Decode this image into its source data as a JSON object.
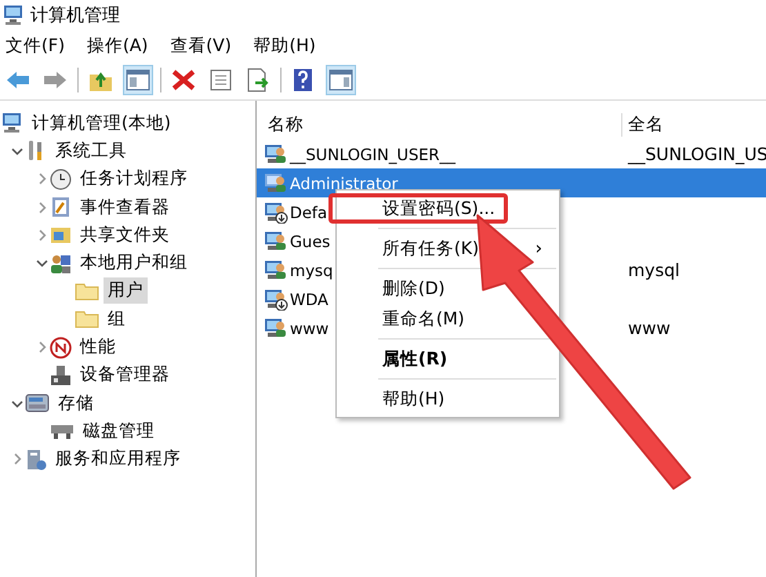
{
  "window": {
    "title": "计算机管理"
  },
  "menu_bar": [
    "文件(F)",
    "操作(A)",
    "查看(V)",
    "帮助(H)"
  ],
  "tree": [
    {
      "label": "计算机管理(本地)",
      "kind": "computer",
      "selected": false,
      "children": [
        {
          "label": "系统工具",
          "kind": "tools",
          "expanded": true,
          "selected": false,
          "children": [
            {
              "label": "任务计划程序",
              "kind": "clock",
              "expanded": false,
              "selected": false
            },
            {
              "label": "事件查看器",
              "kind": "log",
              "expanded": false,
              "selected": false
            },
            {
              "label": "共享文件夹",
              "kind": "share",
              "expanded": false,
              "selected": false
            },
            {
              "label": "本地用户和组",
              "kind": "users",
              "expanded": true,
              "selected": false,
              "children": [
                {
                  "label": "用户",
                  "kind": "folder",
                  "selected": true
                },
                {
                  "label": "组",
                  "kind": "folder",
                  "selected": false
                }
              ]
            },
            {
              "label": "性能",
              "kind": "gauge",
              "expanded": false,
              "selected": false
            },
            {
              "label": "设备管理器",
              "kind": "device",
              "selected": false
            }
          ]
        },
        {
          "label": "存储",
          "kind": "storage",
          "expanded": true,
          "selected": false,
          "children": [
            {
              "label": "磁盘管理",
              "kind": "disk",
              "selected": false
            }
          ]
        },
        {
          "label": "服务和应用程序",
          "kind": "services",
          "expanded": false,
          "selected": false
        }
      ]
    }
  ],
  "list": {
    "columns": [
      "名称",
      "全名"
    ],
    "rows": [
      {
        "name": "__SUNLOGIN_USER__",
        "full_name": "__SUNLOGIN_US",
        "selected": false,
        "disabled": false
      },
      {
        "name": "Administrator",
        "full_name": "",
        "selected": true,
        "disabled": false
      },
      {
        "name": "Defa",
        "full_name": "",
        "selected": false,
        "disabled": true
      },
      {
        "name": "Gues",
        "full_name": "",
        "selected": false,
        "disabled": false
      },
      {
        "name": "mysq",
        "full_name": "mysql",
        "selected": false,
        "disabled": false
      },
      {
        "name": "WDA",
        "full_name": "",
        "selected": false,
        "disabled": true
      },
      {
        "name": "www",
        "full_name": "www",
        "selected": false,
        "disabled": false
      }
    ]
  },
  "context_menu": [
    {
      "kind": "item",
      "label": "设置密码(S)...",
      "default": false,
      "highlighted": true
    },
    {
      "kind": "separator"
    },
    {
      "kind": "submenu",
      "label": "所有任务(K)",
      "arrow": "›",
      "default": false
    },
    {
      "kind": "separator"
    },
    {
      "kind": "item",
      "label": "删除(D)",
      "default": false
    },
    {
      "kind": "item",
      "label": "重命名(M)",
      "default": false
    },
    {
      "kind": "separator"
    },
    {
      "kind": "item",
      "label": "属性(R)",
      "default": true
    },
    {
      "kind": "separator"
    },
    {
      "kind": "item",
      "label": "帮助(H)",
      "default": false
    }
  ]
}
